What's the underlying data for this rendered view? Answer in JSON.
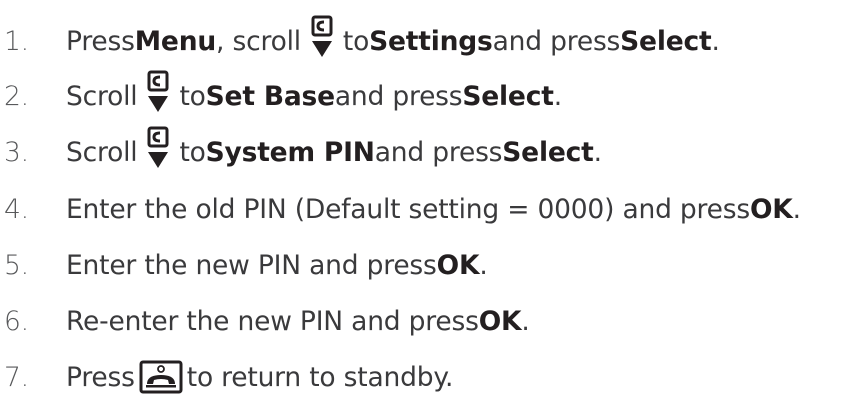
{
  "steps": [
    {
      "number": "1.",
      "parts": [
        {
          "text": "Press ",
          "bold": false
        },
        {
          "text": "Menu",
          "bold": true
        },
        {
          "text": ", scroll",
          "bold": false
        },
        {
          "icon": "scroll-down-icon"
        },
        {
          "text": "to ",
          "bold": false
        },
        {
          "text": "Settings",
          "bold": true
        },
        {
          "text": " and press ",
          "bold": false
        },
        {
          "text": "Select",
          "bold": true
        },
        {
          "text": ".",
          "bold": false
        }
      ]
    },
    {
      "number": "2.",
      "parts": [
        {
          "text": "Scroll",
          "bold": false
        },
        {
          "icon": "scroll-down-icon"
        },
        {
          "text": "to ",
          "bold": false
        },
        {
          "text": "Set Base",
          "bold": true
        },
        {
          "text": " and press ",
          "bold": false
        },
        {
          "text": "Select",
          "bold": true
        },
        {
          "text": ".",
          "bold": false
        }
      ]
    },
    {
      "number": "3.",
      "parts": [
        {
          "text": "Scroll",
          "bold": false
        },
        {
          "icon": "scroll-down-icon"
        },
        {
          "text": "to ",
          "bold": false
        },
        {
          "text": "System PIN",
          "bold": true
        },
        {
          "text": " and press ",
          "bold": false
        },
        {
          "text": "Select",
          "bold": true
        },
        {
          "text": ".",
          "bold": false
        }
      ]
    },
    {
      "number": "4.",
      "parts": [
        {
          "text": "Enter the old PIN (Default setting = 0000) and press ",
          "bold": false
        },
        {
          "text": "OK",
          "bold": true
        },
        {
          "text": ".",
          "bold": false
        }
      ]
    },
    {
      "number": "5.",
      "parts": [
        {
          "text": "Enter the new PIN and press ",
          "bold": false
        },
        {
          "text": "OK",
          "bold": true
        },
        {
          "text": ".",
          "bold": false
        }
      ]
    },
    {
      "number": "6.",
      "parts": [
        {
          "text": "Re-enter the new PIN and press ",
          "bold": false
        },
        {
          "text": "OK",
          "bold": true
        },
        {
          "text": ".",
          "bold": false
        }
      ]
    },
    {
      "number": "7.",
      "parts": [
        {
          "text": "Press",
          "bold": false
        },
        {
          "icon": "end-call-icon"
        },
        {
          "text": "to return to standby.",
          "bold": false
        }
      ]
    }
  ]
}
